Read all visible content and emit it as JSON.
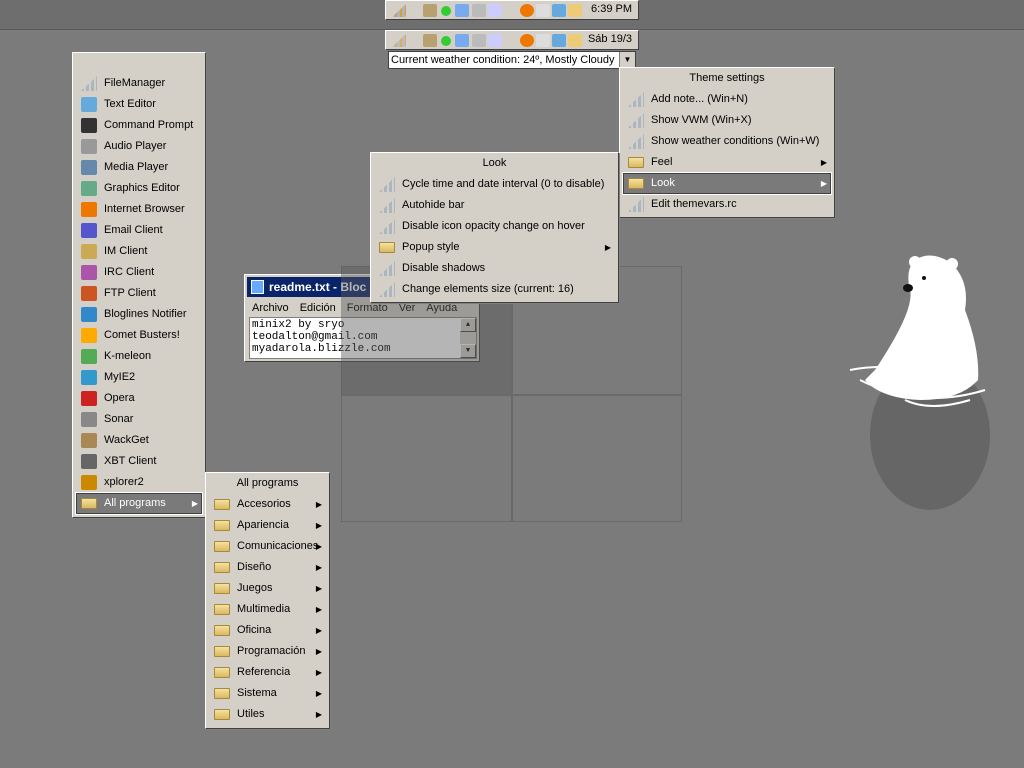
{
  "taskbar_top": {
    "clock": "6:39 PM"
  },
  "taskbar_second": {
    "date": "Sáb 19/3",
    "weather": "Current weather condition: 24º, Mostly Cloudy"
  },
  "start_menu": {
    "items": [
      {
        "label": "FileManager",
        "icon": "bars"
      },
      {
        "label": "Text Editor",
        "icon": "notepad"
      },
      {
        "label": "Command Prompt",
        "icon": "console"
      },
      {
        "label": "Audio Player",
        "icon": "alien"
      },
      {
        "label": "Media Player",
        "icon": "media"
      },
      {
        "label": "Graphics Editor",
        "icon": "palette"
      },
      {
        "label": "Internet Browser",
        "icon": "firefox"
      },
      {
        "label": "Email Client",
        "icon": "envelope"
      },
      {
        "label": "IM Client",
        "icon": "chat"
      },
      {
        "label": "IRC Client",
        "icon": "irc"
      },
      {
        "label": "FTP Client",
        "icon": "ftp"
      },
      {
        "label": "Bloglines Notifier",
        "icon": "bloglines"
      },
      {
        "label": "Comet Busters!",
        "icon": "comet"
      },
      {
        "label": "K-meleon",
        "icon": "chameleon"
      },
      {
        "label": "MyIE2",
        "icon": "myie"
      },
      {
        "label": "Opera",
        "icon": "opera"
      },
      {
        "label": "Sonar",
        "icon": "phone"
      },
      {
        "label": "WackGet",
        "icon": "wackget"
      },
      {
        "label": "XBT Client",
        "icon": "xbt"
      },
      {
        "label": "xplorer2",
        "icon": "xplorer"
      },
      {
        "label": "All programs",
        "icon": "folder",
        "submenu": true,
        "selected": true
      }
    ]
  },
  "all_programs": {
    "title": "All programs",
    "items": [
      {
        "label": "Accesorios"
      },
      {
        "label": "Apariencia"
      },
      {
        "label": "Comunicaciones"
      },
      {
        "label": "Diseño"
      },
      {
        "label": "Juegos"
      },
      {
        "label": "Multimedia"
      },
      {
        "label": "Oficina"
      },
      {
        "label": "Programación"
      },
      {
        "label": "Referencia"
      },
      {
        "label": "Sistema"
      },
      {
        "label": "Utiles"
      }
    ]
  },
  "theme_menu": {
    "title": "Theme settings",
    "items": [
      {
        "label": "Add note... (Win+N)",
        "icon": "bars"
      },
      {
        "label": "Show VWM (Win+X)",
        "icon": "bars"
      },
      {
        "label": "Show weather conditions (Win+W)",
        "icon": "bars"
      },
      {
        "label": "Feel",
        "icon": "folder",
        "submenu": true
      },
      {
        "label": "Look",
        "icon": "folder",
        "submenu": true,
        "selected": true
      },
      {
        "label": "Edit themevars.rc",
        "icon": "bars"
      }
    ]
  },
  "look_menu": {
    "title": "Look",
    "items": [
      {
        "label": "Cycle time and date interval (0 to disable)",
        "icon": "bars"
      },
      {
        "label": "Autohide bar",
        "icon": "bars"
      },
      {
        "label": "Disable icon opacity change on hover",
        "icon": "bars"
      },
      {
        "label": "Popup style",
        "icon": "folder",
        "submenu": true
      },
      {
        "label": "Disable shadows",
        "icon": "bars"
      },
      {
        "label": "Change elements size (current: 16)",
        "icon": "bars"
      }
    ]
  },
  "notepad": {
    "title": "readme.txt - Bloc",
    "menu": [
      "Archivo",
      "Edición",
      "Formato",
      "Ver",
      "Ayuda"
    ],
    "lines": [
      "minix2 by sryo",
      "teodalton@gmail.com",
      "myadarola.blizzle.com"
    ]
  },
  "colors": {
    "desktop": "#7b7b7b",
    "menu": "#d4d0c8",
    "selection": "#7a7a7a",
    "titlebar": "#0a246a"
  }
}
